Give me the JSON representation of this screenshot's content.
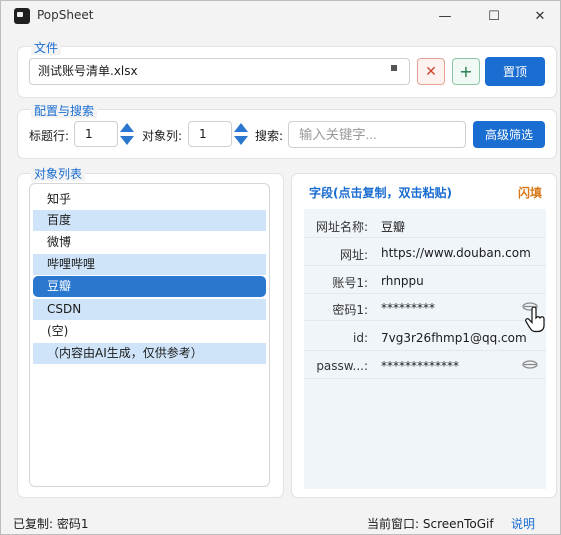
{
  "window": {
    "title": "PopSheet",
    "minimize_glyph": "—",
    "maximize_glyph": "☐",
    "close_glyph": "✕"
  },
  "file_section": {
    "label": "文件",
    "filename": "测试账号清单.xlsx",
    "clear_glyph": "✕",
    "add_glyph": "+",
    "top_button": "置顶"
  },
  "config_section": {
    "label": "配置与搜索",
    "header_row_label": "标题行:",
    "header_row_value": "1",
    "object_col_label": "对象列:",
    "object_col_value": "1",
    "search_label": "搜索:",
    "search_placeholder": "输入关键字...",
    "filter_button": "高级筛选"
  },
  "object_list": {
    "label": "对象列表",
    "items": [
      "知乎",
      "百度",
      "微博",
      "哔哩哔哩",
      "豆瓣",
      "CSDN",
      "(空)",
      "（内容由AI生成，仅供参考）"
    ],
    "selected_index": 4
  },
  "fields": {
    "title": "字段(点击复制，双击粘贴)",
    "flash_button": "闪填",
    "rows": [
      {
        "key": "网址名称:",
        "value": "豆瓣"
      },
      {
        "key": "网址:",
        "value": "https://www.douban.com"
      },
      {
        "key": "账号1:",
        "value": "rhnppu"
      },
      {
        "key": "密码1:",
        "value": "*********"
      },
      {
        "key": "id:",
        "value": "7vg3r26fhmp1@qq.com"
      },
      {
        "key": "passw...:",
        "value": "*************"
      }
    ]
  },
  "status": {
    "copied": "已复制: 密码1",
    "current_window": "当前窗口: ScreenToGif",
    "help": "说明"
  },
  "colors": {
    "accent": "#1a6dd1",
    "selected": "#2a77d0",
    "alt_row": "#cfe4f8",
    "flash": "#d87a1b",
    "clear": "#d0462c",
    "add": "#1f7a45"
  }
}
